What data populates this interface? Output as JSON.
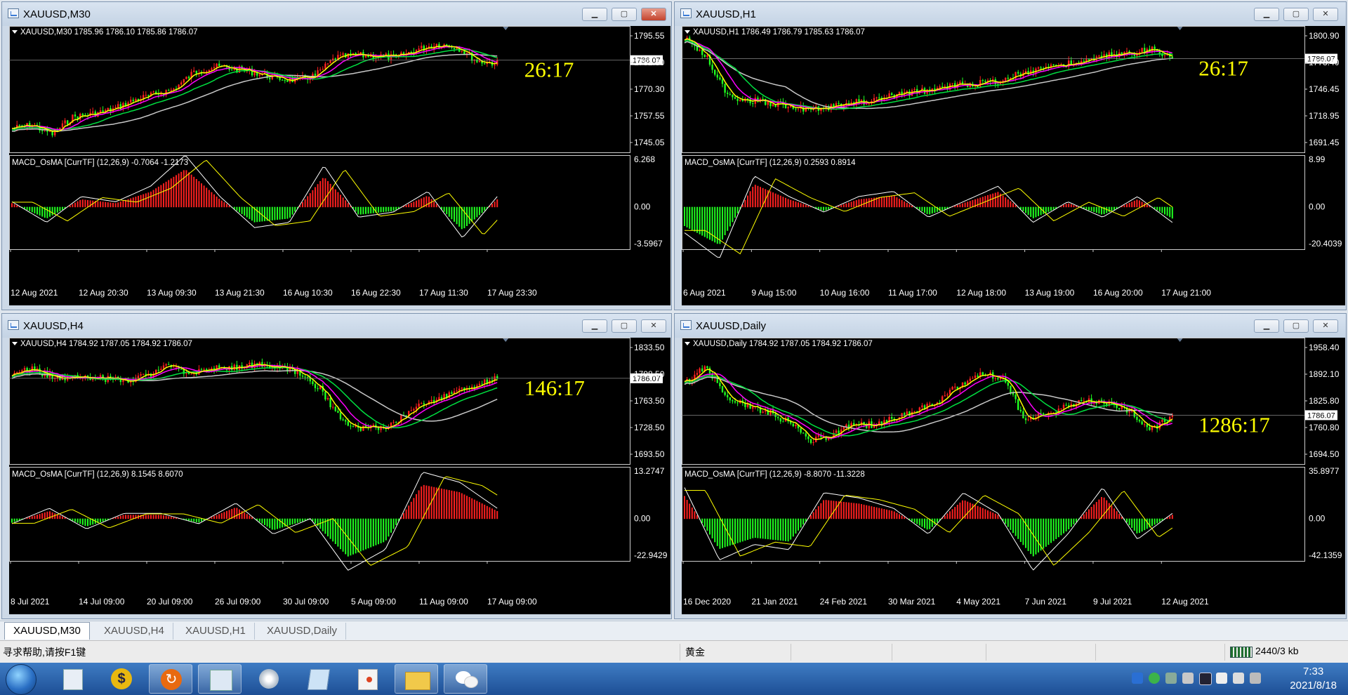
{
  "windows": [
    {
      "key": "m30",
      "title": "XAUUSD,M30",
      "header": "XAUUSD,M30  1785.96 1786.10 1785.86 1786.07",
      "timer": "26:17",
      "price_ticks": [
        "1795.55",
        "1782.80",
        "1770.30",
        "1757.55",
        "1745.05"
      ],
      "current_price": "1786.07",
      "macd_label": "MACD_OsMA [CurrTF] (12,26,9) -0.7064 -1.2173",
      "macd_ticks": [
        "6.268",
        "0.00",
        "-3.5967"
      ],
      "time_ticks": [
        "12 Aug 2021",
        "12 Aug 20:30",
        "13 Aug 09:30",
        "13 Aug 21:30",
        "16 Aug 10:30",
        "16 Aug 22:30",
        "17 Aug 11:30",
        "17 Aug 23:30"
      ],
      "close_style": "red"
    },
    {
      "key": "h1",
      "title": "XAUUSD,H1",
      "header": "XAUUSD,H1  1786.49 1786.79 1785.63 1786.07",
      "timer": "26:17",
      "price_ticks": [
        "1800.90",
        "1773.40",
        "1746.45",
        "1718.95",
        "1691.45"
      ],
      "current_price": "1786.07",
      "macd_label": "MACD_OsMA [CurrTF] (12,26,9) 0.2593 0.8914",
      "macd_ticks": [
        "8.99",
        "0.00",
        "-20.4039"
      ],
      "time_ticks": [
        "6 Aug 2021",
        "9 Aug 15:00",
        "10 Aug 16:00",
        "11 Aug 17:00",
        "12 Aug 18:00",
        "13 Aug 19:00",
        "16 Aug 20:00",
        "17 Aug 21:00"
      ],
      "close_style": "plain"
    },
    {
      "key": "h4",
      "title": "XAUUSD,H4",
      "header": "XAUUSD,H4  1784.92 1787.05 1784.92 1786.07",
      "timer": "146:17",
      "price_ticks": [
        "1833.50",
        "1798.50",
        "1763.50",
        "1728.50",
        "1693.50"
      ],
      "current_price": "1786.07",
      "macd_label": "MACD_OsMA [CurrTF] (12,26,9) 8.1545 8.6070",
      "macd_ticks": [
        "13.2747",
        "0.00",
        "-22.9429"
      ],
      "time_ticks": [
        "8 Jul 2021",
        "14 Jul 09:00",
        "20 Jul 09:00",
        "26 Jul 09:00",
        "30 Jul 09:00",
        "5 Aug 09:00",
        "11 Aug 09:00",
        "17 Aug 09:00"
      ],
      "close_style": "plain"
    },
    {
      "key": "d1",
      "title": "XAUUSD,Daily",
      "header": "XAUUSD,Daily  1784.92 1787.05 1784.92 1786.07",
      "timer": "1286:17",
      "price_ticks": [
        "1958.40",
        "1892.10",
        "1825.80",
        "1760.80",
        "1694.50"
      ],
      "current_price": "1786.07",
      "macd_label": "MACD_OsMA [CurrTF] (12,26,9) -8.8070 -11.3228",
      "macd_ticks": [
        "35.8977",
        "0.00",
        "-42.1359"
      ],
      "time_ticks": [
        "16 Dec 2020",
        "21 Jan 2021",
        "24 Feb 2021",
        "30 Mar 2021",
        "4 May 2021",
        "7 Jun 2021",
        "9 Jul 2021",
        "12 Aug 2021"
      ],
      "close_style": "plain"
    }
  ],
  "tabs": [
    "XAUUSD,M30",
    "XAUUSD,H4",
    "XAUUSD,H1",
    "XAUUSD,Daily"
  ],
  "active_tab": 0,
  "status": {
    "help": "寻求帮助,请按F1键",
    "profile": "黄金",
    "traffic": "2440/3 kb"
  },
  "clock": {
    "time": "7:33",
    "date": "2021/8/18"
  },
  "taskbar_apps": [
    "start-orb",
    "contacts-app",
    "dollar-app",
    "arrow-app",
    "network-app",
    "disc-app",
    "notebook-app",
    "paint-app",
    "folder-app",
    "wechat-app"
  ],
  "colors": {
    "bull": "#ff2020",
    "bear": "#20ff20",
    "ma_fast": "#ffff00",
    "ma_mid": "#ff00ff",
    "ma_slow": "#00e040",
    "ma_long": "#c8c8c8",
    "timer": "#ffff00"
  }
}
